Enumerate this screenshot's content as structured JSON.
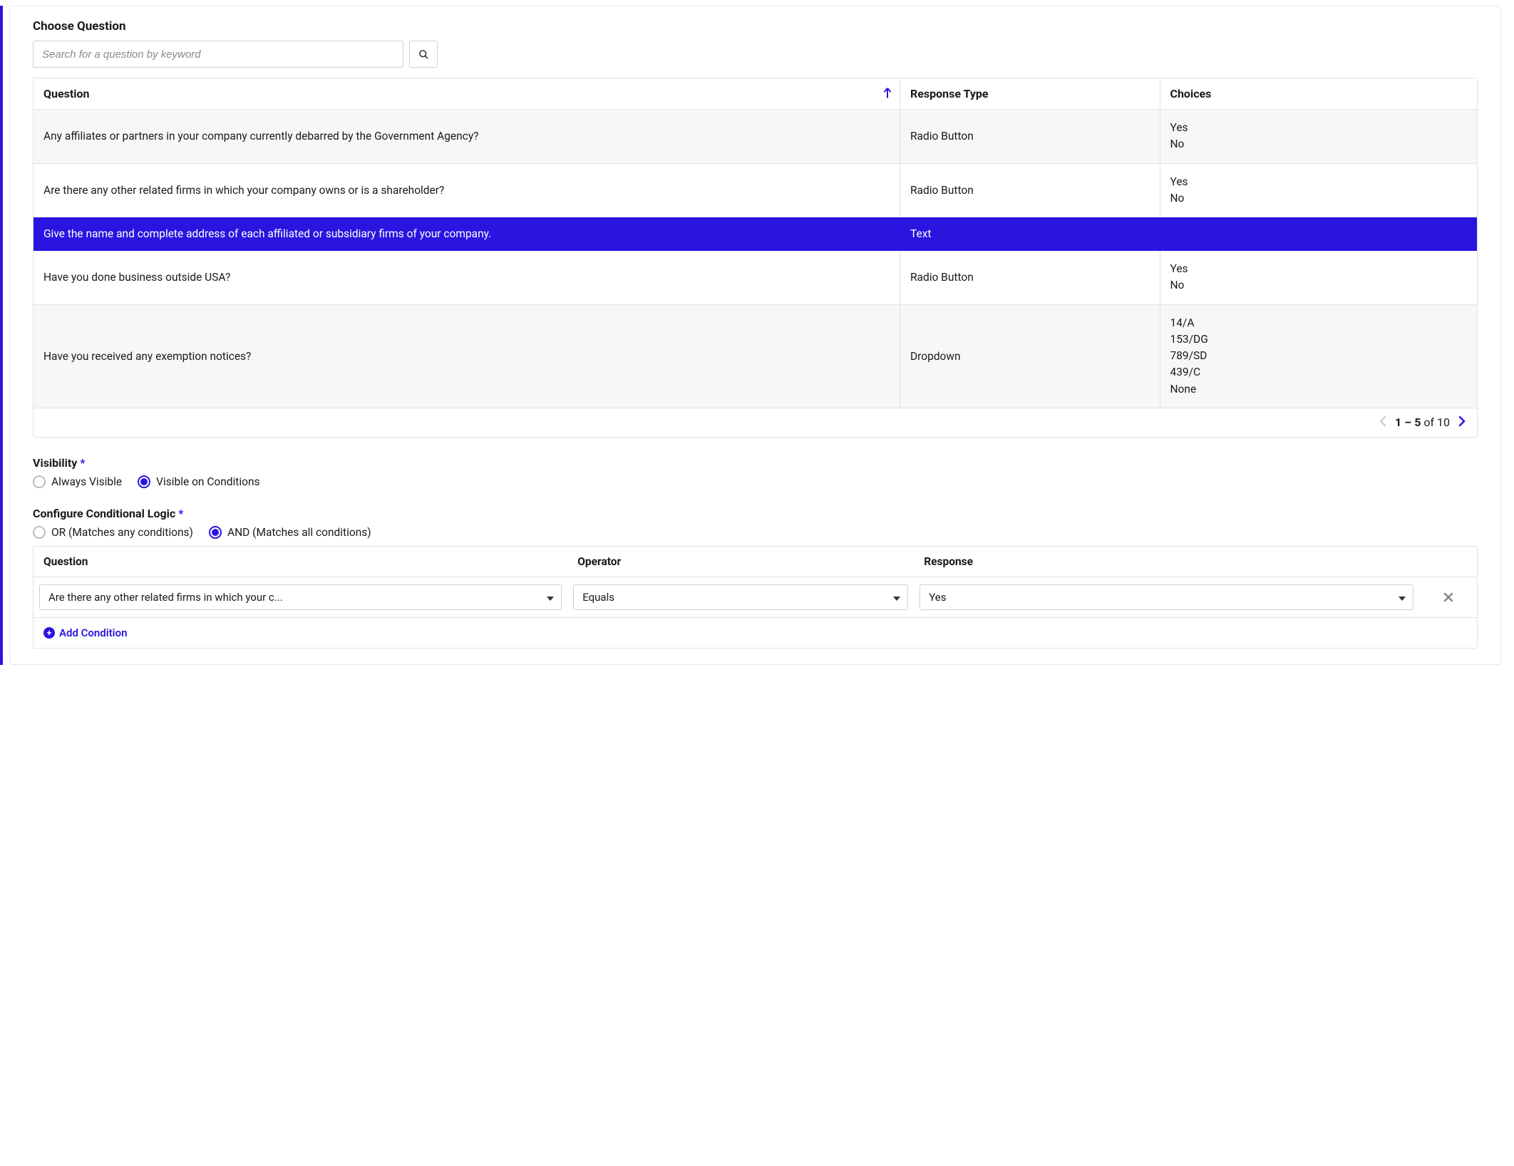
{
  "choose": {
    "title": "Choose Question",
    "search_placeholder": "Search for a question by keyword"
  },
  "table": {
    "headers": {
      "question": "Question",
      "response_type": "Response Type",
      "choices": "Choices"
    },
    "rows": [
      {
        "question": "Any affiliates or partners in your company currently debarred by the Government Agency?",
        "type": "Radio Button",
        "choices": [
          "Yes",
          "No"
        ],
        "selected": false
      },
      {
        "question": "Are there any other related firms in which your company owns or is a shareholder?",
        "type": "Radio Button",
        "choices": [
          "Yes",
          "No"
        ],
        "selected": false
      },
      {
        "question": "Give the name and complete address of each affiliated or subsidiary firms of your company.",
        "type": "Text",
        "choices": [],
        "selected": true
      },
      {
        "question": "Have you done business outside USA?",
        "type": "Radio Button",
        "choices": [
          "Yes",
          "No"
        ],
        "selected": false
      },
      {
        "question": "Have you received any exemption notices?",
        "type": "Dropdown",
        "choices": [
          "14/A",
          "153/DG",
          "789/SD",
          "439/C",
          "None"
        ],
        "selected": false
      }
    ],
    "pager": {
      "range": "1 – 5",
      "of_word": "of",
      "total": "10"
    }
  },
  "visibility": {
    "title": "Visibility",
    "always": "Always Visible",
    "conditional": "Visible on Conditions"
  },
  "logic": {
    "title": "Configure Conditional Logic",
    "or": "OR (Matches any conditions)",
    "and": "AND (Matches all conditions)",
    "headers": {
      "question": "Question",
      "operator": "Operator",
      "response": "Response"
    },
    "row": {
      "question": "Are there any other related firms in which your c...",
      "operator": "Equals",
      "response": "Yes"
    },
    "add": "Add Condition"
  }
}
